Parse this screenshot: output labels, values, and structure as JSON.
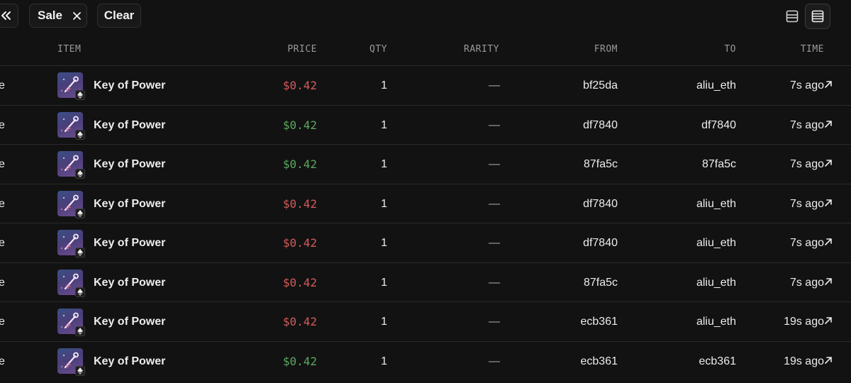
{
  "toolbar": {
    "collapse_icon": "chevrons-left-icon",
    "filter_chip": {
      "label": "Sale",
      "close_icon": "close-icon"
    },
    "clear_label": "Clear",
    "views": [
      {
        "icon": "rows-compact-icon",
        "active": false
      },
      {
        "icon": "rows-list-icon",
        "active": true
      }
    ]
  },
  "table": {
    "headers": {
      "item": "ITEM",
      "price": "PRICE",
      "qty": "QTY",
      "rarity": "RARITY",
      "from": "FROM",
      "to": "TO",
      "time": "TIME"
    },
    "rows": [
      {
        "type": "e",
        "item": "Key of Power",
        "price": "$0.42",
        "price_color": "#d35b5b",
        "qty": "1",
        "rarity": "—",
        "from": "bf25da",
        "to": "aliu_eth",
        "time": "7s ago"
      },
      {
        "type": "e",
        "item": "Key of Power",
        "price": "$0.42",
        "price_color": "#5aa85e",
        "qty": "1",
        "rarity": "—",
        "from": "df7840",
        "to": "df7840",
        "time": "7s ago"
      },
      {
        "type": "e",
        "item": "Key of Power",
        "price": "$0.42",
        "price_color": "#5aa85e",
        "qty": "1",
        "rarity": "—",
        "from": "87fa5c",
        "to": "87fa5c",
        "time": "7s ago"
      },
      {
        "type": "e",
        "item": "Key of Power",
        "price": "$0.42",
        "price_color": "#d35b5b",
        "qty": "1",
        "rarity": "—",
        "from": "df7840",
        "to": "aliu_eth",
        "time": "7s ago"
      },
      {
        "type": "e",
        "item": "Key of Power",
        "price": "$0.42",
        "price_color": "#d35b5b",
        "qty": "1",
        "rarity": "—",
        "from": "df7840",
        "to": "aliu_eth",
        "time": "7s ago"
      },
      {
        "type": "e",
        "item": "Key of Power",
        "price": "$0.42",
        "price_color": "#d35b5b",
        "qty": "1",
        "rarity": "—",
        "from": "87fa5c",
        "to": "aliu_eth",
        "time": "7s ago"
      },
      {
        "type": "e",
        "item": "Key of Power",
        "price": "$0.42",
        "price_color": "#d35b5b",
        "qty": "1",
        "rarity": "—",
        "from": "ecb361",
        "to": "aliu_eth",
        "time": "19s ago"
      },
      {
        "type": "e",
        "item": "Key of Power",
        "price": "$0.42",
        "price_color": "#5aa85e",
        "qty": "1",
        "rarity": "—",
        "from": "ecb361",
        "to": "ecb361",
        "time": "19s ago"
      }
    ]
  }
}
